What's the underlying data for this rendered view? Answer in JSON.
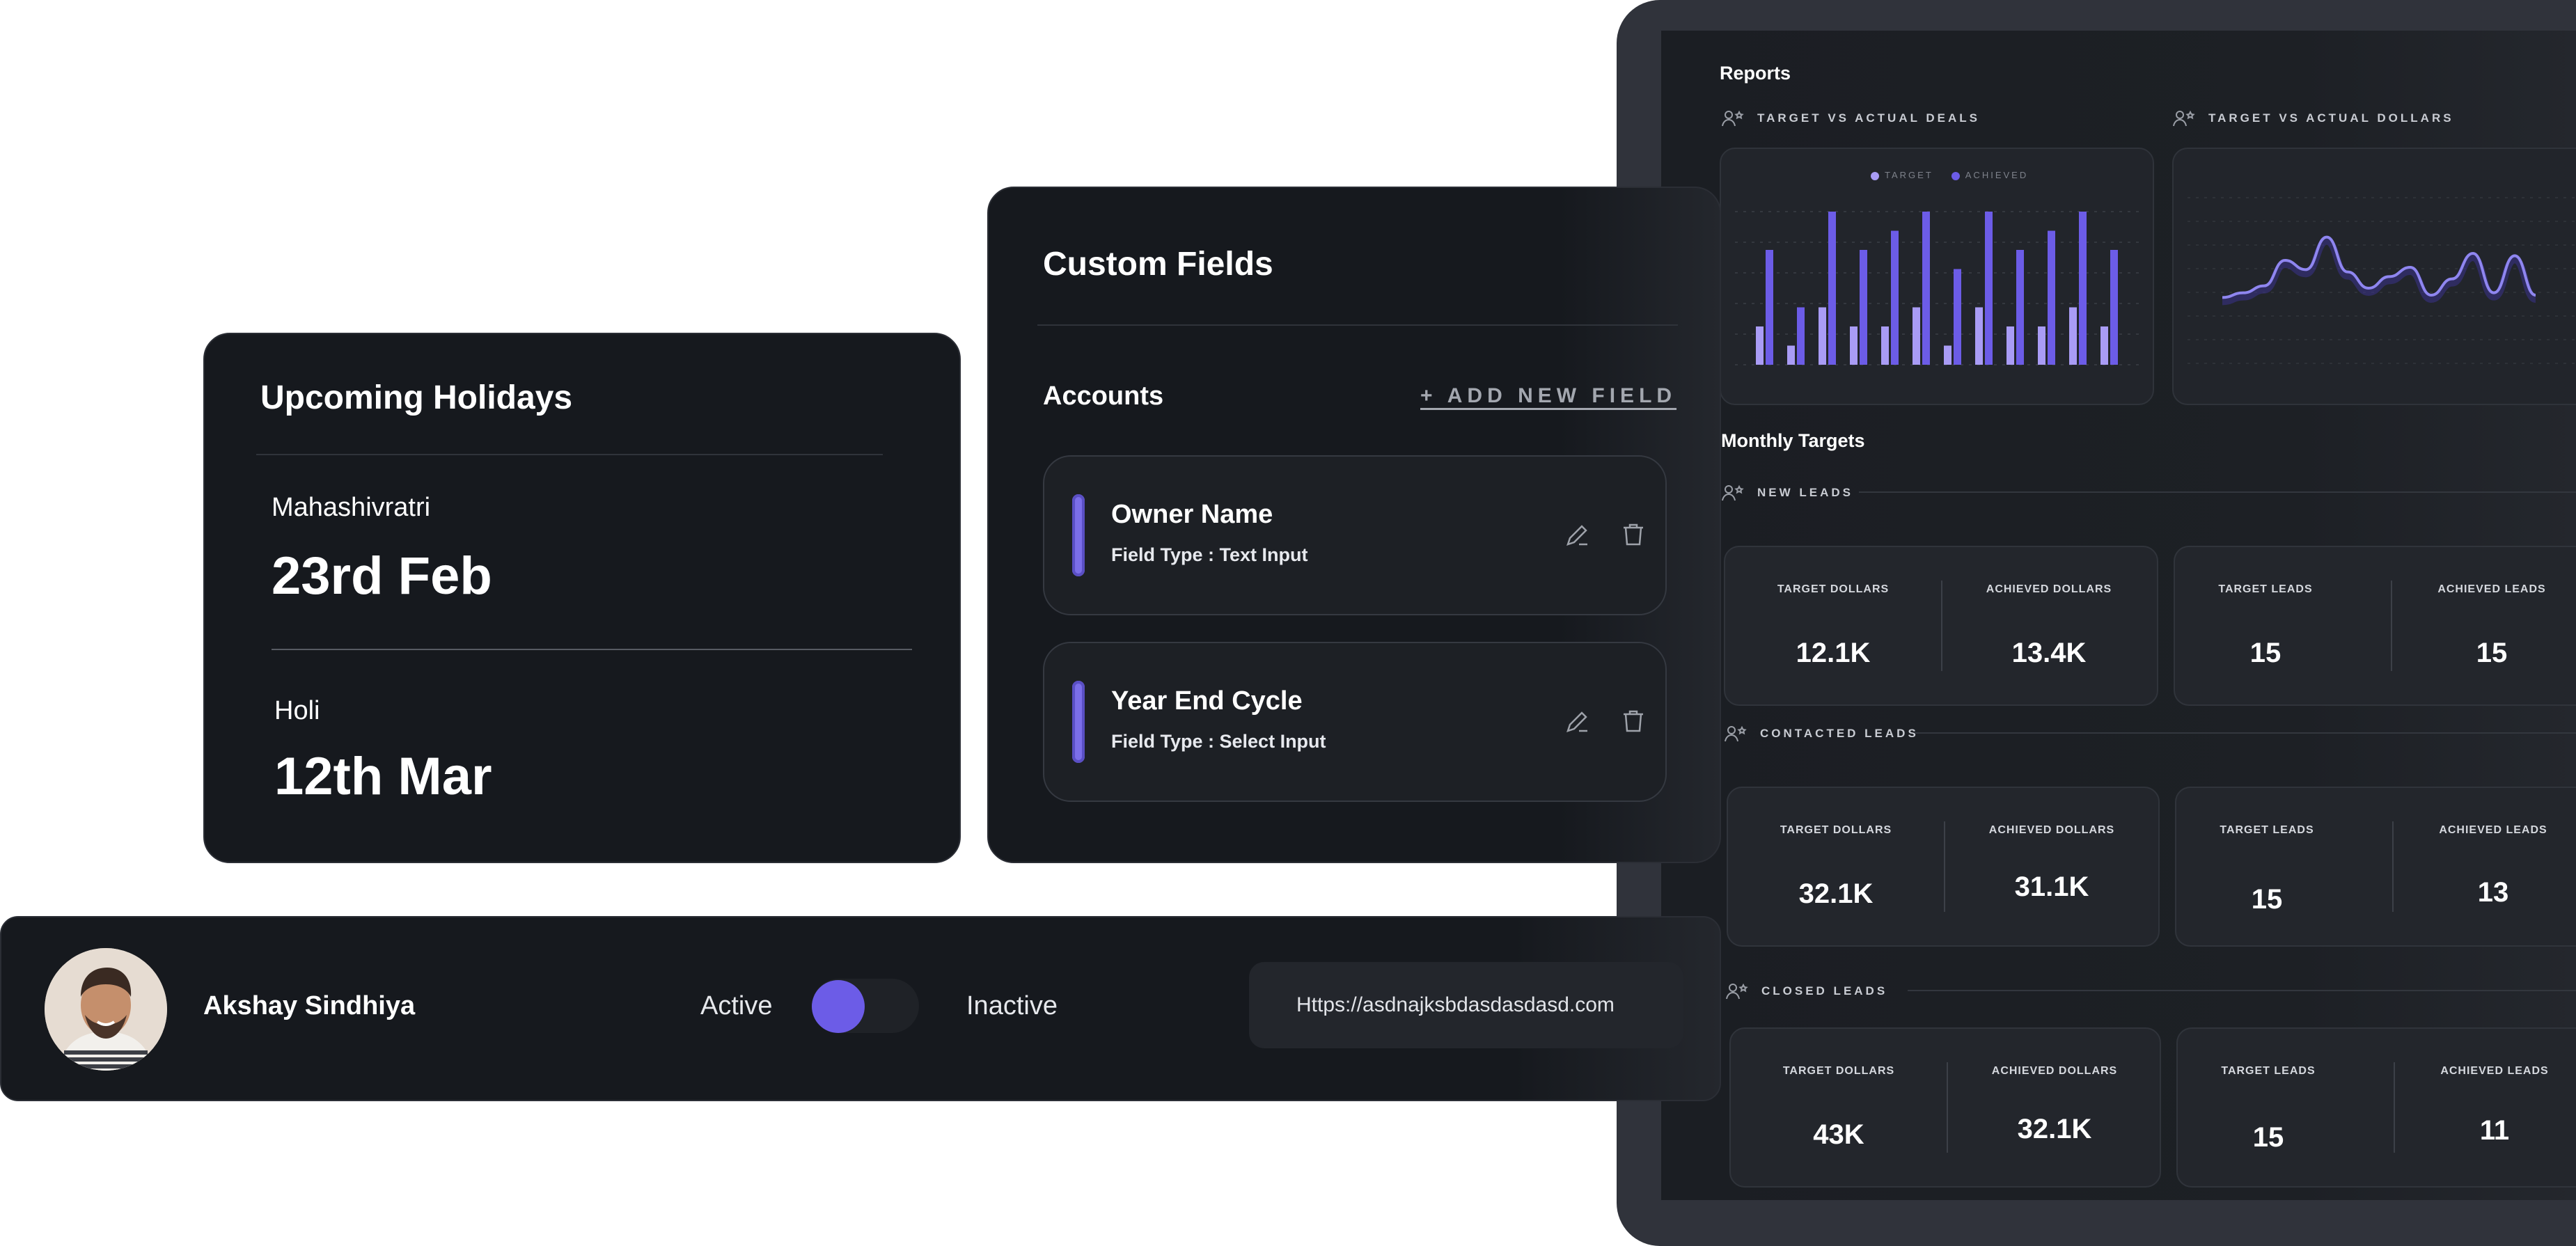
{
  "holidays": {
    "title": "Upcoming Holidays",
    "items": [
      {
        "name": "Mahashivratri",
        "date": "23rd Feb"
      },
      {
        "name": "Holi",
        "date": "12th Mar"
      }
    ]
  },
  "custom_fields": {
    "title": "Custom Fields",
    "section": "Accounts",
    "add_label": "+ ADD NEW FIELD",
    "fields": [
      {
        "name": "Owner Name",
        "type": "Field Type : Text Input"
      },
      {
        "name": "Year End Cycle",
        "type": "Field Type : Select Input"
      }
    ]
  },
  "profile": {
    "name": "Akshay Sindhiya",
    "active_label": "Active",
    "inactive_label": "Inactive",
    "url": "Https://asdnajksbdasdasdasd.com",
    "toggle_state": "active"
  },
  "reports": {
    "title": "Reports",
    "deals_label": "TARGET VS ACTUAL DEALS",
    "dollars_label": "TARGET VS ACTUAL DOLLARS",
    "legend_target": "TARGET",
    "legend_achieved": "ACHIEVED",
    "monthly_title": "Monthly Targets",
    "sections": [
      {
        "label": "NEW LEADS",
        "dollars": {
          "target_label": "TARGET DOLLARS",
          "target": "12.1K",
          "achieved_label": "ACHIEVED DOLLARS",
          "achieved": "13.4K"
        },
        "leads": {
          "target_label": "TARGET LEADS",
          "target": "15",
          "achieved_label": "ACHIEVED LEADS",
          "achieved": "15"
        }
      },
      {
        "label": "CONTACTED LEADS",
        "dollars": {
          "target_label": "TARGET DOLLARS",
          "target": "32.1K",
          "achieved_label": "ACHIEVED DOLLARS",
          "achieved": "31.1K"
        },
        "leads": {
          "target_label": "TARGET LEADS",
          "target": "15",
          "achieved_label": "ACHIEVED LEADS",
          "achieved": "13"
        }
      },
      {
        "label": "CLOSED LEADS",
        "dollars": {
          "target_label": "TARGET DOLLARS",
          "target": "43K",
          "achieved_label": "ACHIEVED DOLLARS",
          "achieved": "32.1K"
        },
        "leads": {
          "target_label": "TARGET LEADS",
          "target": "15",
          "achieved_label": "ACHIEVED LEADS",
          "achieved": "11"
        }
      }
    ],
    "colors": {
      "target": "#a99cf5",
      "achieved": "#6c5ce7",
      "line": "#8f86f0"
    }
  },
  "chart_data": [
    {
      "type": "bar",
      "series": [
        {
          "name": "TARGET",
          "values": [
            2,
            1,
            3,
            2,
            2,
            3,
            1,
            3,
            2,
            2,
            3,
            2
          ]
        },
        {
          "name": "ACHIEVED",
          "values": [
            6,
            3,
            8,
            6,
            7,
            8,
            5,
            8,
            6,
            7,
            8,
            6
          ]
        }
      ]
    },
    {
      "type": "line",
      "series": [
        {
          "values": [
            2,
            2.2,
            2.5,
            3.6,
            3.2,
            4.6,
            3.1,
            2.4,
            2.9,
            3.3,
            2.1,
            2.8,
            3.9,
            2.2,
            3.8,
            2.1
          ]
        }
      ]
    }
  ]
}
